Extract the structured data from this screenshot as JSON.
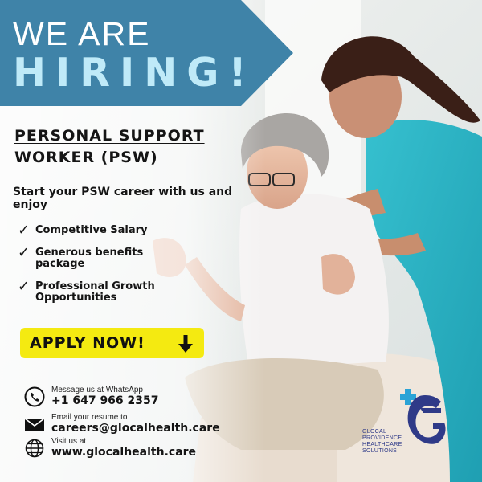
{
  "banner": {
    "line1": "WE ARE",
    "line2": "HIRING!"
  },
  "job": {
    "title": "PERSONAL SUPPORT WORKER (PSW)",
    "intro": "Start your PSW career with us and enjoy"
  },
  "benefits": [
    {
      "icon": "checkmark-icon",
      "label": "Competitive Salary"
    },
    {
      "icon": "checkmark-icon",
      "label": "Generous benefits package"
    },
    {
      "icon": "checkmark-icon",
      "label": "Professional Growth Opportunities"
    }
  ],
  "apply": {
    "label": "APPLY NOW!",
    "icon": "arrow-down-icon",
    "color": "#f4ea11"
  },
  "contacts": [
    {
      "icon": "phone-icon",
      "caption": "Message us at WhatsApp",
      "value": "+1 647 966 2357"
    },
    {
      "icon": "envelope-icon",
      "caption": "Email your resume to",
      "value": "careers@glocalhealth.care"
    },
    {
      "icon": "globe-icon",
      "caption": "Visit us at",
      "value": "www.glocalhealth.care"
    }
  ],
  "logo": {
    "line1": "GLOCAL",
    "line2": "PROVIDENCE",
    "line3": "HEALTHCARE",
    "line4": "SOLUTIONS",
    "brand_color": "#2f3a88",
    "accent_color": "#2aa3d6"
  },
  "colors": {
    "banner": "#3f83a8",
    "hiring_text": "#bfeaf8",
    "scrubs": "#2bb3c4"
  }
}
